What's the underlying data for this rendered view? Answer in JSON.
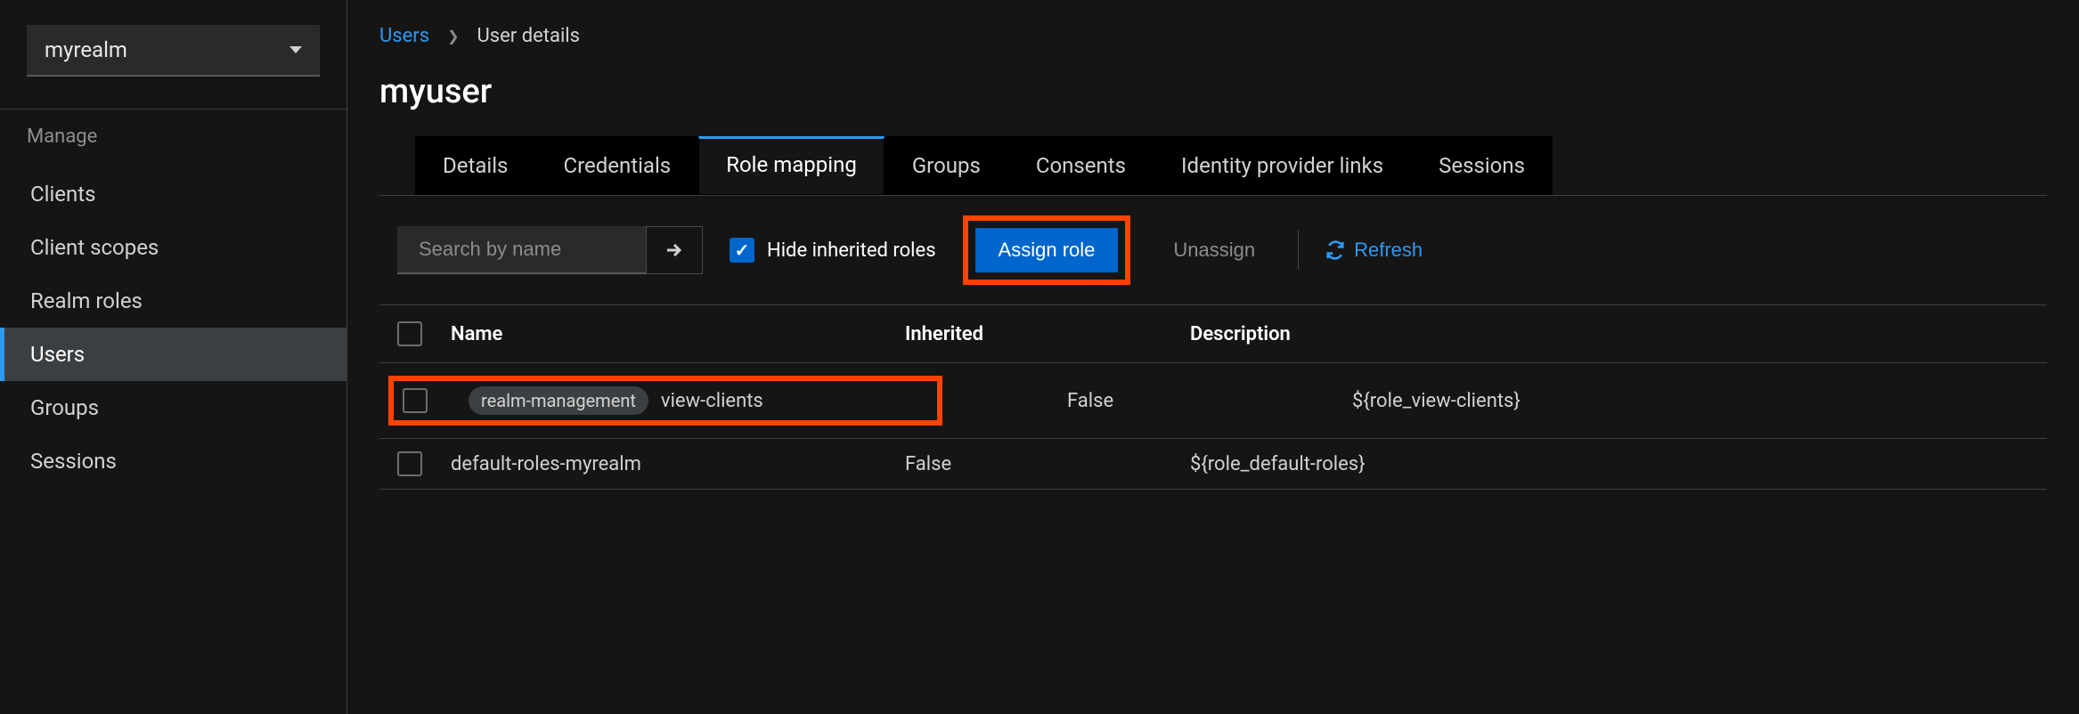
{
  "sidebar": {
    "realm": "myrealm",
    "section_label": "Manage",
    "items": [
      {
        "label": "Clients"
      },
      {
        "label": "Client scopes"
      },
      {
        "label": "Realm roles"
      },
      {
        "label": "Users"
      },
      {
        "label": "Groups"
      },
      {
        "label": "Sessions"
      }
    ]
  },
  "breadcrumb": {
    "root": "Users",
    "current": "User details"
  },
  "page_title": "myuser",
  "tabs": [
    {
      "label": "Details"
    },
    {
      "label": "Credentials"
    },
    {
      "label": "Role mapping"
    },
    {
      "label": "Groups"
    },
    {
      "label": "Consents"
    },
    {
      "label": "Identity provider links"
    },
    {
      "label": "Sessions"
    }
  ],
  "toolbar": {
    "search_placeholder": "Search by name",
    "hide_inherited_label": "Hide inherited roles",
    "hide_inherited_checked": true,
    "assign_role_label": "Assign role",
    "unassign_label": "Unassign",
    "refresh_label": "Refresh"
  },
  "table": {
    "columns": {
      "name": "Name",
      "inherited": "Inherited",
      "description": "Description"
    },
    "rows": [
      {
        "badge": "realm-management",
        "name": "view-clients",
        "inherited": "False",
        "description": "${role_view-clients}",
        "highlighted": true
      },
      {
        "badge": null,
        "name": "default-roles-myrealm",
        "inherited": "False",
        "description": "${role_default-roles}",
        "highlighted": false
      }
    ]
  }
}
